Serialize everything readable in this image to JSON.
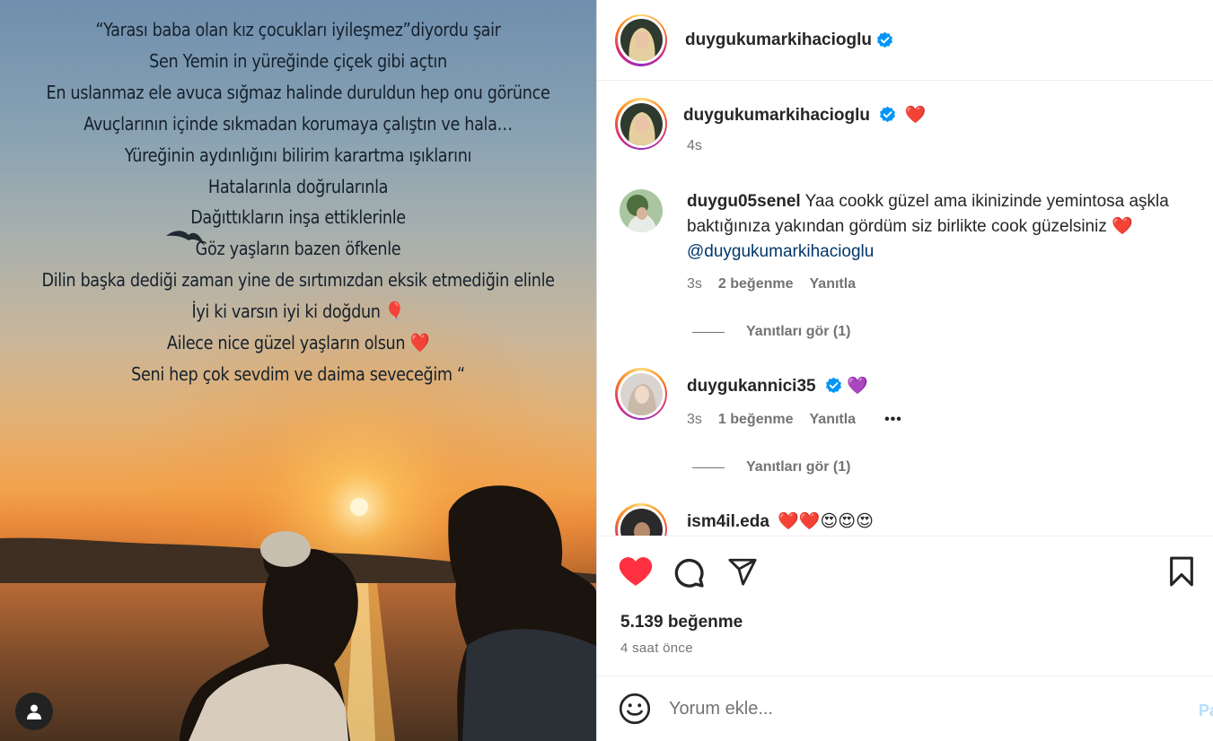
{
  "image": {
    "poem_lines": [
      "“Yarası baba olan kız çocukları iyileşmez”diyordu şair",
      "Sen Yemin in yüreğinde çiçek gibi açtın",
      "En uslanmaz ele avuca sığmaz halinde duruldun hep onu görünce",
      "Avuçlarının içinde sıkmadan korumaya çalıştın ve hala…",
      "Yüreğinin aydınlığını bilirim karartma ışıklarını",
      "Hatalarınla doğrularınla",
      "Dağıttıkların inşa ettiklerinle",
      "Göz yaşların bazen öfkenle",
      "Dilin başka dediği zaman yine de sırtımızdan eksik etmediğin elinle",
      "İyi ki varsın iyi ki doğdun 🎈",
      "Ailece nice güzel yaşların olsun ❤️",
      "Seni hep çok sevdim ve daima seveceğim “"
    ]
  },
  "header": {
    "username": "duygukumarkihacioglu"
  },
  "caption": {
    "username": "duygukumarkihacioglu",
    "text": "❤️",
    "time": "4s"
  },
  "comments": [
    {
      "username": "duygu05senel",
      "text": "Yaa cookk güzel ama ikinizinde yemintosa aşkla baktığınıza yakından gördüm siz birlikte cook güzelsiniz ❤️",
      "mention": "@duygukumarkihacioglu",
      "time": "3s",
      "likes": "2 beğenme",
      "reply": "Yanıtla",
      "view_replies": "Yanıtları gör (1)"
    },
    {
      "username": "duygukannici35",
      "text": "💜",
      "time": "3s",
      "likes": "1 beğenme",
      "reply": "Yanıtla",
      "more": "•••",
      "view_replies": "Yanıtları gör (1)"
    },
    {
      "username": "ism4il.eda",
      "text": "❤️❤️😍😍😍"
    }
  ],
  "actions": {
    "likes": "5.139 beğenme",
    "time": "4 saat önce"
  },
  "comment_box": {
    "placeholder": "Yorum ekle...",
    "post_label": "Pa"
  },
  "colors": {
    "like_red": "#ff3040",
    "verified_blue": "#0095f6",
    "link_blue": "#00376b",
    "muted": "#737373"
  }
}
